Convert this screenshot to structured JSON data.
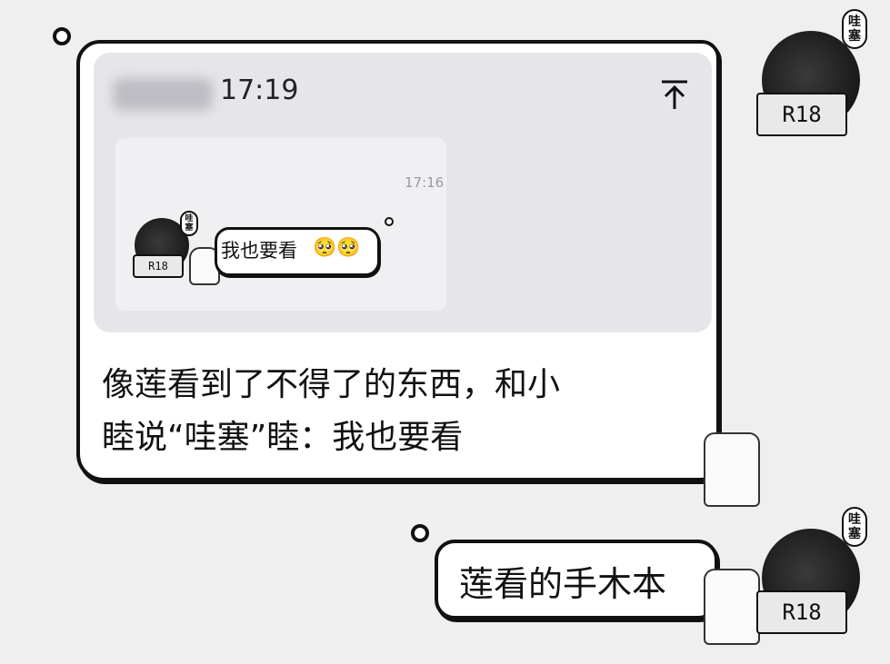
{
  "quoted_message": {
    "time": "17:19",
    "screenshot": {
      "time": "17:16",
      "message_text": "我也要看",
      "emoji": "🥺🥺",
      "avatar_tag": "哇塞",
      "avatar_book_label": "R18"
    }
  },
  "main_message": {
    "line1": "像莲看到了不得了的东西，和小",
    "line2": "睦说“哇塞”睦：我也要看"
  },
  "reply_message": {
    "text": "莲看的手木本"
  },
  "avatar_top": {
    "tag": "哇塞",
    "book_label": "R18"
  },
  "avatar_bottom": {
    "tag": "哇塞",
    "book_label": "R18"
  }
}
